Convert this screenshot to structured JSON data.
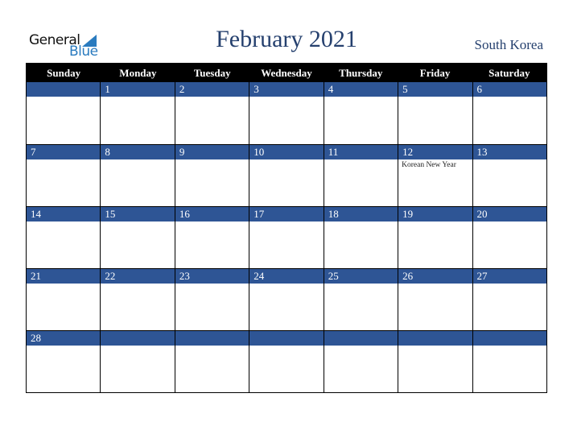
{
  "logo": {
    "line1": "General",
    "line2": "Blue"
  },
  "header": {
    "title": "February 2021",
    "country": "South Korea"
  },
  "colors": {
    "accent": "#2e5595",
    "title": "#25406e",
    "header_bg": "#000000",
    "logo_blue": "#2a7bbf"
  },
  "weekdays": [
    "Sunday",
    "Monday",
    "Tuesday",
    "Wednesday",
    "Thursday",
    "Friday",
    "Saturday"
  ],
  "weeks": [
    [
      {
        "day": ""
      },
      {
        "day": "1"
      },
      {
        "day": "2"
      },
      {
        "day": "3"
      },
      {
        "day": "4"
      },
      {
        "day": "5"
      },
      {
        "day": "6"
      }
    ],
    [
      {
        "day": "7"
      },
      {
        "day": "8"
      },
      {
        "day": "9"
      },
      {
        "day": "10"
      },
      {
        "day": "11"
      },
      {
        "day": "12",
        "event": "Korean New Year"
      },
      {
        "day": "13"
      }
    ],
    [
      {
        "day": "14"
      },
      {
        "day": "15"
      },
      {
        "day": "16"
      },
      {
        "day": "17"
      },
      {
        "day": "18"
      },
      {
        "day": "19"
      },
      {
        "day": "20"
      }
    ],
    [
      {
        "day": "21"
      },
      {
        "day": "22"
      },
      {
        "day": "23"
      },
      {
        "day": "24"
      },
      {
        "day": "25"
      },
      {
        "day": "26"
      },
      {
        "day": "27"
      }
    ],
    [
      {
        "day": "28"
      },
      {
        "day": ""
      },
      {
        "day": ""
      },
      {
        "day": ""
      },
      {
        "day": ""
      },
      {
        "day": ""
      },
      {
        "day": ""
      }
    ]
  ]
}
